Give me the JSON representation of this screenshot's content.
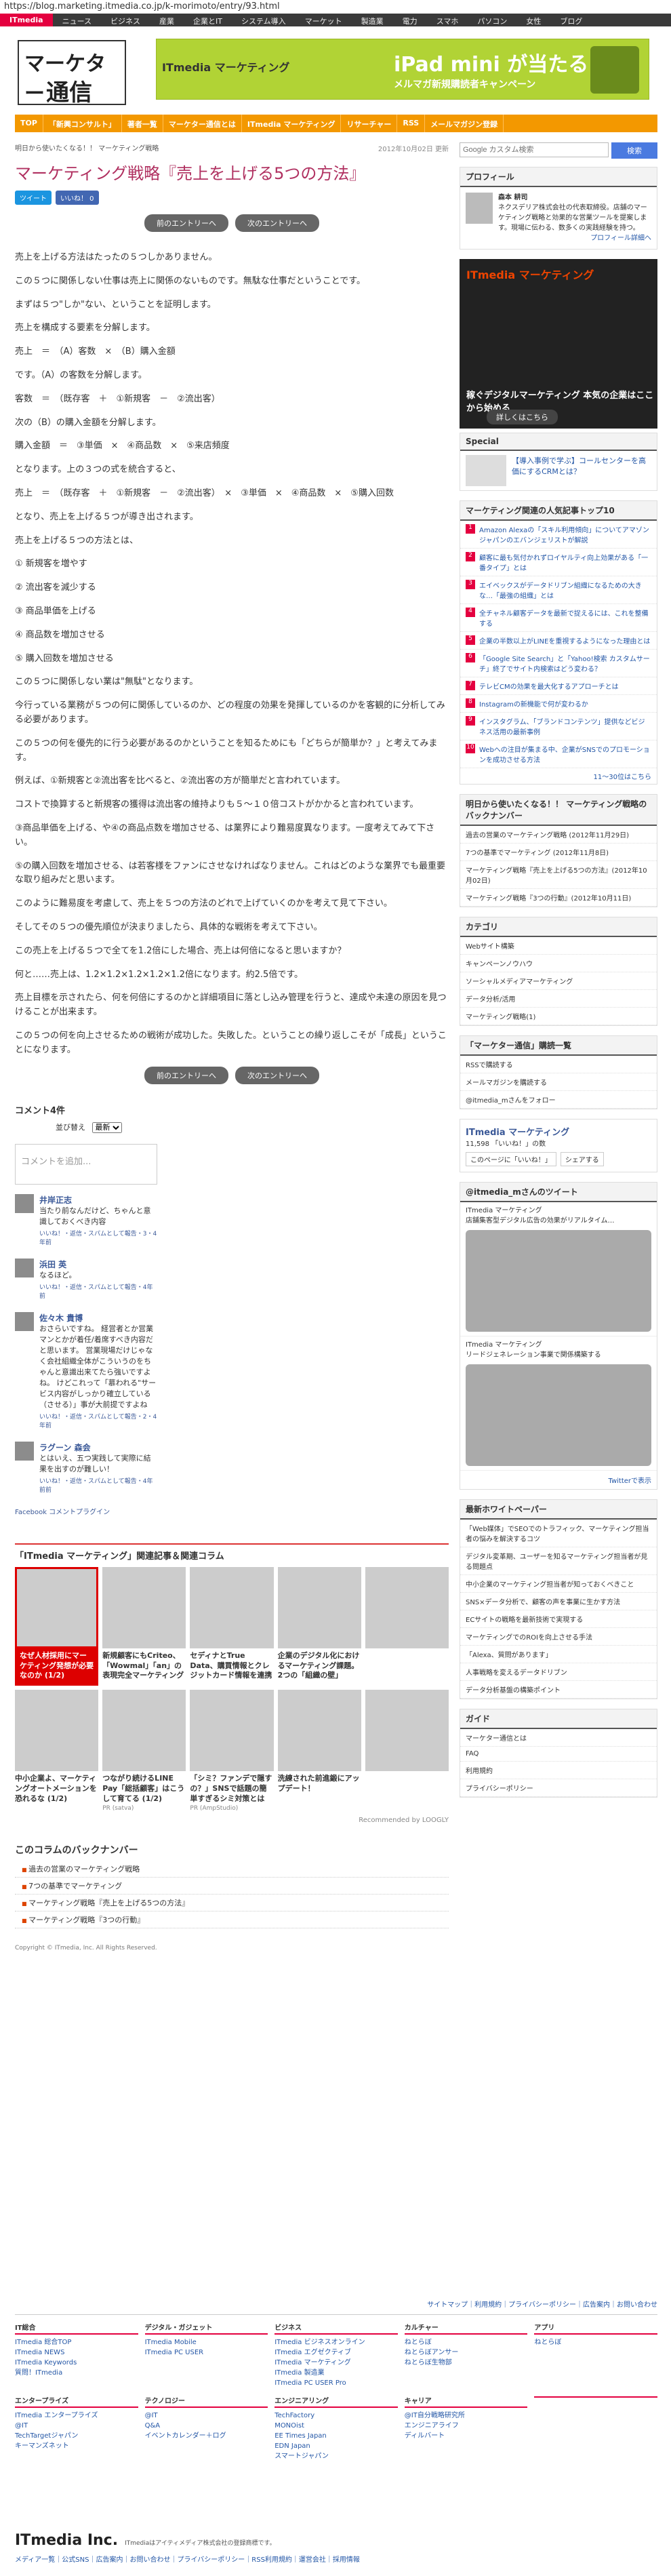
{
  "browser": {
    "url": "https://blog.marketing.itmedia.co.jp/k-morimoto/entry/93.html"
  },
  "topnav": [
    "ITmedia",
    "ニュース",
    "ビジネス",
    "産業",
    "企業とIT",
    "システム導入",
    "マーケット",
    "製造業",
    "電力",
    "スマホ",
    "パソコン",
    "女性",
    "ブログ"
  ],
  "header": {
    "logo_line1": "マーケター",
    "logo_line2": "通信",
    "banner_left": "ITmedia マーケティング",
    "banner_title": "iPad mini が当たる",
    "banner_sub": "メルマガ新規購読者キャンペーン"
  },
  "orangenav": [
    "TOP",
    "「新興コンサルト」",
    "著者一覧",
    "マーケター通信とは",
    "ITmedia マーケティング",
    "リサーチャー",
    "RSS",
    "メールマガジン登録"
  ],
  "article": {
    "crumb": "明日から使いたくなる！！ マーケティング戦略",
    "date": "2012年10月02日 更新",
    "title": "マーケティング戦略『売上を上げる5つの方法』",
    "share": {
      "tweet": "ツイート",
      "like": "いいね！ 0"
    },
    "prev": "前のエントリーへ",
    "next": "次のエントリーへ",
    "paragraphs": [
      "売上を上げる方法はたったの５つしかありません。",
      "この５つに関係しない仕事は売上に関係のないものです。無駄な仕事だということです。",
      "まずは５つ\"しか\"ない、ということを証明します。",
      "売上を構成する要素を分解します。",
      "売上　＝　（A）客数　×　（B）購入金額",
      "です。（A）の客数を分解します。",
      "客数　＝　（既存客　＋　①新規客　－　②流出客）",
      "次の（B）の購入金額を分解します。",
      "購入金額　＝　③単価　×　④商品数　×　⑤来店頻度",
      "となります。上の３つの式を統合すると、",
      "売上　＝　（既存客　＋　①新規客　－　②流出客）　×　③単価　×　④商品数　×　⑤購入回数",
      "となり、売上を上げる５つが導き出されます。",
      "売上を上げる５つの方法とは、",
      "① 新規客を増やす",
      "② 流出客を減少する",
      "③ 商品単価を上げる",
      "④ 商品数を増加させる",
      "⑤ 購入回数を増加させる",
      "この５つに関係しない業は\"無駄\"となります。",
      "今行っている業務が５つの何に関係しているのか、どの程度の効果を発揮しているのかを客観的に分析してみる必要があります。",
      "この５つの何を優先的に行う必要があるのかということを知るためにも「どちらが簡単か？」と考えてみます。",
      "例えば、①新規客と②流出客を比べると、②流出客の方が簡単だと言われています。",
      "コストで換算すると新規客の獲得は流出客の維持よりも５〜１０倍コストがかかると言われています。",
      "③商品単価を上げる、や④の商品点数を増加させる、は業界により難易度異なります。一度考えてみて下さい。",
      "⑤の購入回数を増加させる、は若客様をファンにさせなければなりません。これはどのような業界でも最重要な取り組みだと思います。",
      "このように難易度を考慮して、売上を５つの方法のどれで上げていくのかを考えて見て下さい。",
      "そしてその５つの優先順位が決まりましたら、具体的な戦術を考えて下さい。",
      "この売上を上げる５つで全てを1.2倍にした場合、売上は何倍になると思いますか？",
      "何と……売上は、1.2×1.2×1.2×1.2×1.2倍になります。約2.5倍です。",
      "売上目標を示されたら、何を何倍にするのかと詳細項目に落とし込み管理を行うと、達成や未達の原因を見つけることが出来ます。",
      "この５つの何を向上させるための戦術が成功した。失敗した。ということの繰り返しこそが「成長」ということになります。"
    ]
  },
  "comments": {
    "count_label": "コメント4件",
    "sort_label": "並び替え",
    "sort_value": "最新",
    "placeholder": "コメントを追加...",
    "items": [
      {
        "name": "井岸正志",
        "text": "当たり前なんだけど、ちゃんと意識しておくべき内容",
        "meta": "いいね！・返信・スパムとして報告・3・4年前"
      },
      {
        "name": "浜田 英",
        "text": "なるほど。",
        "meta": "いいね！・返信・スパムとして報告・4年前"
      },
      {
        "name": "佐々木 貴博",
        "text": "おさらいですね。\n経営者とか営業マンとかが着任/着席すべき内容だと思います。\n営業現場だけじゃなく会社組織全体がこういうのをちゃんと意識出来てたら強いですよね。\n\nけどこれって「慕われる\"サービス内容がしっかり確立している（させる）」事が大前提ですよね",
        "meta": "いいね！・返信・スパムとして報告・2・4年前"
      },
      {
        "name": "ラグーン 森会",
        "text": "とはいえ、五つ実践して実際に結果を出すのが難しい！",
        "meta": "いいね！・返信・スパムとして報告・4年前前"
      }
    ],
    "plugin": "Facebook コメントプラグイン"
  },
  "related": {
    "heading": "「ITmedia マーケティング」関連記事＆関連コラム",
    "cards": [
      {
        "text": "なぜ人材採用にマーケティング発想が必要なのか (1/2)",
        "src": ""
      },
      {
        "text": "新規顧客にもCriteo、「Wowmal」「an」の表現完全マーケティング",
        "src": ""
      },
      {
        "text": "セディナとTrue Data、購買情報とクレジットカード情報を連携",
        "src": ""
      },
      {
        "text": "企業のデジタル化におけるマーケティング課題。2つの「組織の壁」",
        "src": ""
      },
      {
        "text": "",
        "src": ""
      },
      {
        "text": "中小企業よ、マーケティングオートメーションを恐れるな (1/2)",
        "src": ""
      },
      {
        "text": "つながり続けるLINE Pay「総括顧客」はこうして育てる (1/2)",
        "src": "PR (satva)"
      },
      {
        "text": "「シミ？ファンデで隠すの？」SNSで話題の簡単すぎるシミ対策とは",
        "src": "PR (AmpStudio)"
      },
      {
        "text": "洗練された前進鍛にアップデート！",
        "src": ""
      },
      {
        "text": "",
        "src": ""
      }
    ],
    "recommended": "Recommended by LOOGLY"
  },
  "backnumbers": {
    "heading": "このコラムのバックナンバー",
    "items": [
      "過去の営業のマーケティング戦略",
      "7つの基準でマーケティング",
      "マーケティング戦略『売上を上げる5つの方法』",
      "マーケティング戦略『3つの行動』"
    ]
  },
  "copyright": "Copyright © ITmedia, Inc. All Rights Reserved.",
  "sidebar": {
    "search_placeholder": "Google カスタム検索",
    "search_button": "検索",
    "profile_h": "プロフィール",
    "profile_name": "森本 耕司",
    "profile_text": "ネクスデリア株式会社の代表取締役。店舗のマーケティング戦略と効果的な営業ツールを提案します。現場に伝わる、数多くの実践経験を持つ。",
    "profile_more": "プロフィール詳細へ",
    "ad2_t1": "ITmedia マーケティング",
    "ad2_t2": "稼ぐデジタルマーケティング 本気の企業はここから始める",
    "ad2_t3": "詳しくはこちら",
    "special_h": "Special",
    "special_text": "【導入事例で学ぶ】コールセンターを高価にするCRMとは？",
    "ranking_h": "マーケティング関連の人気記事トップ10",
    "ranking": [
      "Amazon Alexaの「スキル利用傾向」についてアマゾンジャパンのエバンジェリストが解説",
      "顧客に最も気付かれずロイヤルティ向上効果がある「一番タイプ」とは",
      "エイベックスがデータドリブン組織になるための大きな…「最強の組織」とは",
      "全チャネル顧客データを最新で捉えるには、これを整備する",
      "企業の半数以上がLINEを重視するようになった理由とは",
      "「Google Site Search」と「Yahoo!検索 カスタムサーチ」終了でサイト内検索はどう変わる？",
      "テレビCMの効果を最大化するアプローチとは",
      "Instagramの新機能で何が変わるか",
      "インスタグラム、「ブランドコンテンツ」提供などビジネス活用の最新事例",
      "Webへの注目が集まる中、企業がSNSでのプロモーションを成功させる方法"
    ],
    "ranking_more": "11〜30位はこちら",
    "back_h": "明日から使いたくなる！！ マーケティング戦略のバックナンバー",
    "back": [
      "過去の営業のマーケティング戦略 (2012年11月29日)",
      "7つの基準でマーケティング (2012年11月8日)",
      "マーケティング戦略『売上を上げる5つの方法』(2012年10月02日)",
      "マーケティング戦略『3つの行動』(2012年10月11日)"
    ],
    "cat_h": "カテゴリ",
    "cats": [
      "Webサイト構築",
      "キャンペーンノウハウ",
      "ソーシャルメディアマーケティング",
      "データ分析/活用",
      "マーケティング戦略(1)"
    ],
    "rss_h": "「マーケター通信」購読一覧",
    "rss": [
      "RSSで購読する",
      "メールマガジンを購読する",
      "@itmedia_mさんをフォロー"
    ],
    "fb_name": "ITmedia マーケティング",
    "fb_likes": "11,598 「いいね！」の数",
    "fb_like": "このページに「いいね！」",
    "fb_share": "シェアする",
    "tw_h": "@itmedia_mさんのツイート",
    "tweets": [
      {
        "name": "ITmedia マーケティング",
        "text": "店舗集客型デジタル広告の効果がリアルタイム…"
      },
      {
        "name": "ITmedia マーケティング",
        "text": "リードジェネレーション事業で関係構築する"
      }
    ],
    "tw_more": "Twitterで表示",
    "wp_h": "最新ホワイトペーパー",
    "wp": [
      "「Web媒体」でSEOでのトラフィック、マーケティング担当者の悩みを解決するコツ",
      "デジタル変革期、ユーザーを知るマーケティング担当者が見る問題点",
      "中小企業のマーケティング担当者が知っておくべきこと",
      "SNS×データ分析で、顧客の声を事業に生かす方法",
      "ECサイトの戦略を最新技術で実現する",
      "マーケティングでのROIを向上させる手法",
      "「Alexa、質問があります」",
      "人事戦略を変えるデータドリブン",
      "データ分析基盤の構築ポイント"
    ],
    "guide_h": "ガイド",
    "guide": [
      "マーケター通信とは",
      "FAQ",
      "利用規約",
      "プライバシーポリシー"
    ]
  },
  "footer": {
    "toplinks": "サイトマップ｜利用規約｜プライバシーポリシー｜広告案内｜お問い合わせ",
    "cols": [
      {
        "h": "IT総合",
        "items": [
          "ITmedia 総合TOP",
          "ITmedia NEWS",
          "ITmedia Keywords",
          "質問！ITmedia"
        ]
      },
      {
        "h": "デジタル・ガジェット",
        "items": [
          "ITmedia Mobile",
          "ITmedia PC USER"
        ]
      },
      {
        "h": "ビジネス",
        "items": [
          "ITmedia ビジネスオンライン",
          "ITmedia エグゼクティブ",
          "ITmedia マーケティング",
          "ITmedia 製造業",
          "ITmedia PC USER Pro"
        ]
      },
      {
        "h": "カルチャー",
        "items": [
          "ねとらぼ",
          "ねとらぼアンサー",
          "ねとらぼ生物部"
        ]
      },
      {
        "h": "アプリ",
        "items": [
          "ねとらぼ"
        ]
      },
      {
        "h": "エンタープライズ",
        "items": [
          "ITmedia エンタープライズ",
          "@IT",
          "TechTargetジャパン",
          "キーマンズネット"
        ]
      },
      {
        "h": "テクノロジー",
        "items": [
          "@IT",
          "Q&A",
          "イベントカレンダー＋ログ"
        ]
      },
      {
        "h": "エンジニアリング",
        "items": [
          "TechFactory",
          "MONOist",
          "EE Times Japan",
          "EDN Japan",
          "スマートジャパン"
        ]
      },
      {
        "h": "キャリア",
        "items": [
          "@IT自分戦略研究所",
          "エンジニアライフ",
          "ディルバート"
        ]
      },
      {
        "h": "",
        "items": []
      }
    ],
    "company": "ITmedia Inc.",
    "company_note": "ITmediaはアイティメディア株式会社の登録商標です。",
    "bottom": "メディア一覧｜公式SNS｜広告案内｜お問い合わせ｜プライバシーポリシー｜RSS利用規約｜運営会社｜採用情報"
  }
}
